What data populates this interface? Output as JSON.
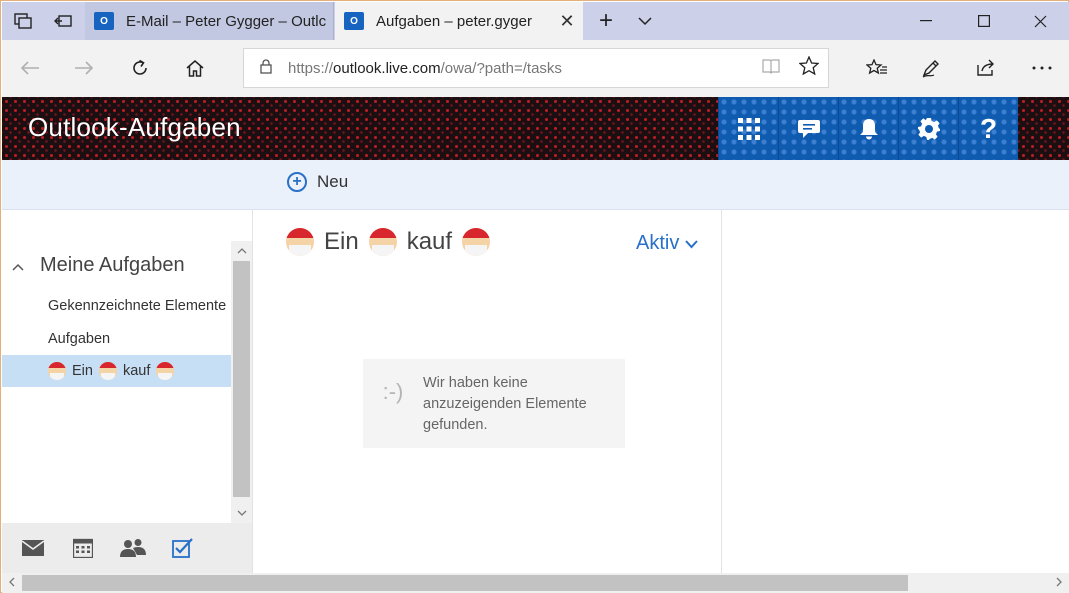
{
  "browser": {
    "tabs": [
      {
        "title": "E-Mail – Peter Gygger – Outlc",
        "icon": "outlook-icon",
        "icon_text": "O"
      },
      {
        "title": "Aufgaben – peter.gyger",
        "icon": "outlook-icon",
        "icon_text": "O",
        "close": "✕"
      }
    ],
    "tab_actions": {
      "new_tab": "+",
      "tab_list": "⌵"
    },
    "window": {
      "minimize": "—",
      "maximize": "☐",
      "close": "✕"
    },
    "address": {
      "scheme": "https://",
      "host": "outlook.live.com",
      "path": "/owa/?path=/tasks"
    }
  },
  "app": {
    "title": "Outlook-Aufgaben",
    "header_buttons": [
      "app-launcher",
      "chat",
      "notifications",
      "settings",
      "help"
    ]
  },
  "command_bar": {
    "new_label": "Neu"
  },
  "sidebar": {
    "section_title": "Meine Aufgaben",
    "items": [
      {
        "label": "Gekennzeichnete Elemente"
      },
      {
        "label": "Aufgaben"
      },
      {
        "label_part1": "Ein",
        "label_part2": "kauf"
      }
    ]
  },
  "task_list": {
    "title_part1": "Ein",
    "title_part2": "kauf",
    "filter_label": "Aktiv",
    "empty_smiley": ":-)",
    "empty_message": "Wir haben keine anzuzeigenden Elemente gefunden."
  },
  "modules": [
    "mail",
    "calendar",
    "people",
    "tasks"
  ],
  "colors": {
    "accent": "#2870c8",
    "header_button": "#0f5bb0",
    "selected": "#c7dff5"
  }
}
